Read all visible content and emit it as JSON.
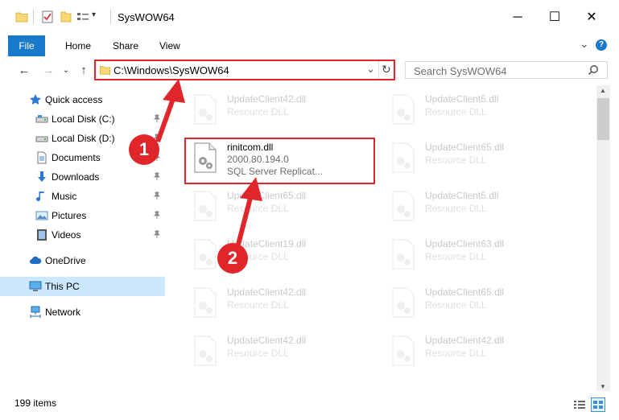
{
  "window": {
    "title": "SysWOW64",
    "minimize_glyph": "─",
    "maximize_glyph": "☐",
    "close_glyph": "✕",
    "customize_glyph": "▾"
  },
  "ribbon": {
    "tabs": [
      "File",
      "Home",
      "Share",
      "View"
    ],
    "expand_glyph": "⌄",
    "help_glyph": "?"
  },
  "address": {
    "back_glyph": "←",
    "forward_glyph": "→",
    "recent_glyph": "⌄",
    "up_glyph": "↑",
    "path": "C:\\Windows\\SysWOW64",
    "dropdown_glyph": "⌄",
    "refresh_glyph": "↻"
  },
  "search": {
    "placeholder": "Search SysWOW64",
    "icon": "search-icon"
  },
  "navigation": {
    "items": [
      {
        "label": "Quick access",
        "icon": "star-icon",
        "pinned": false
      },
      {
        "label": "Local Disk (C:)",
        "icon": "drive-icon",
        "pinned": true
      },
      {
        "label": "Local Disk (D:)",
        "icon": "drive-icon",
        "pinned": true
      },
      {
        "label": "Documents",
        "icon": "documents-icon",
        "pinned": true
      },
      {
        "label": "Downloads",
        "icon": "download-icon",
        "pinned": true
      },
      {
        "label": "Music",
        "icon": "music-icon",
        "pinned": true
      },
      {
        "label": "Pictures",
        "icon": "pictures-icon",
        "pinned": true
      },
      {
        "label": "Videos",
        "icon": "videos-icon",
        "pinned": true
      },
      {
        "label": "OneDrive",
        "icon": "cloud-icon",
        "pinned": false
      },
      {
        "label": "This PC",
        "icon": "computer-icon",
        "pinned": false,
        "selected": true
      },
      {
        "label": "Network",
        "icon": "network-icon",
        "pinned": false
      }
    ]
  },
  "files": {
    "highlighted": {
      "name": "rinitcom.dll",
      "version": "2000.80.194.0",
      "type": "SQL Server Replicat..."
    },
    "faded_left": [
      {
        "name": "UpdateClient42.dll",
        "desc": "Resource DLL"
      },
      {
        "name": "UpdateClient65.dll",
        "desc": "Resource DLL"
      },
      {
        "name": "UpdateClient19.dll",
        "desc": "Resource DLL"
      },
      {
        "name": "UpdateClient42.dll",
        "desc": "Resource DLL"
      },
      {
        "name": "UpdateClient42.dll",
        "desc": "Resource DLL"
      }
    ],
    "faded_right": [
      {
        "name": "UpdateClient5.dll",
        "desc": "Resource DLL"
      },
      {
        "name": "UpdateClient65.dll",
        "desc": "Resource DLL"
      },
      {
        "name": "UpdateClient5.dll",
        "desc": "Resource DLL"
      },
      {
        "name": "UpdateClient63.dll",
        "desc": "Resource DLL"
      },
      {
        "name": "UpdateClient65.dll",
        "desc": "Resource DLL"
      },
      {
        "name": "UpdateClient42.dll",
        "desc": "Resource DLL"
      }
    ]
  },
  "status": {
    "item_count": "199 items"
  },
  "annotations": {
    "step1": "1",
    "step2": "2",
    "accent_color": "#e0262b"
  }
}
